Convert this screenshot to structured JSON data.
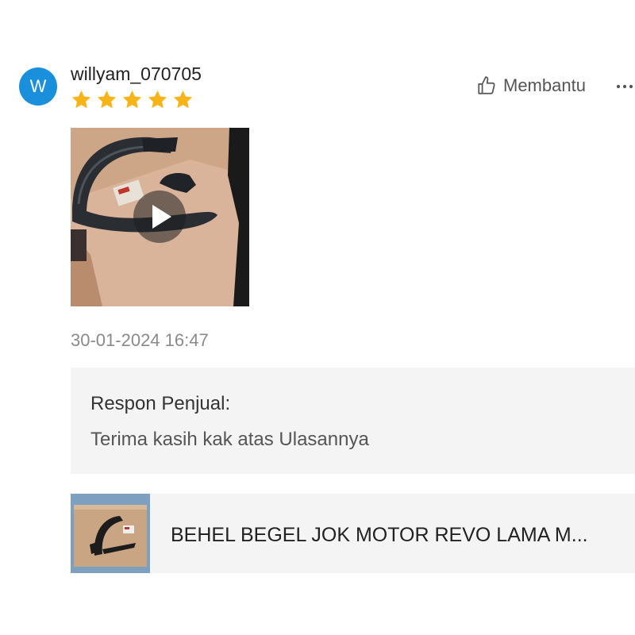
{
  "review": {
    "avatar_initial": "W",
    "username": "willyam_070705",
    "rating": 5,
    "rating_max": 5,
    "star_color": "#f6b418",
    "helpful_label": "Membantu",
    "more_icon": "more-horizontal-icon",
    "media": {
      "type": "video",
      "icon": "play-icon"
    },
    "timestamp": "30-01-2024 16:47"
  },
  "seller_reply": {
    "heading": "Respon Penjual:",
    "text": "Terima kasih kak atas Ulasannya"
  },
  "product": {
    "title": "BEHEL BEGEL JOK MOTOR REVO LAMA M..."
  },
  "colors": {
    "avatar": "#1a8fdc",
    "panel_bg": "#f4f4f4"
  }
}
